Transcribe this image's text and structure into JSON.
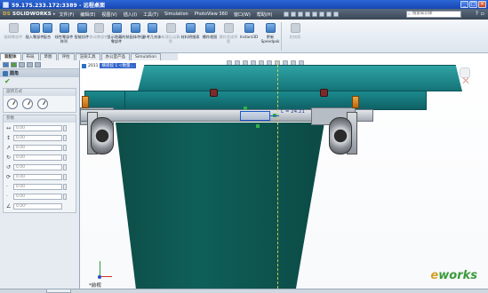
{
  "remote_desktop": {
    "title": "59.175.233.172:3389 - 远程桌面"
  },
  "app": {
    "logo": "SOLIDWORKS",
    "menu": [
      "文件(F)",
      "编辑(E)",
      "视图(V)",
      "插入(I)",
      "工具(T)",
      "Simulation",
      "PhotoView 360",
      "窗口(W)",
      "帮助(H)"
    ],
    "search_placeholder": "搜索知识库"
  },
  "ribbon": {
    "buttons": [
      {
        "label": "编辑零部件",
        "active": false
      },
      {
        "label": "插入零部件",
        "active": true
      },
      {
        "label": "配合",
        "active": true
      },
      {
        "label": "线性零部件阵列",
        "active": true
      },
      {
        "label": "智能扣件",
        "active": true
      },
      {
        "label": "移动零部件",
        "active": false
      },
      {
        "label": "显示隐藏的零部件",
        "active": true
      },
      {
        "label": "装配体特征",
        "active": true
      },
      {
        "label": "参考几何体",
        "active": true
      },
      {
        "label": "新建运动算例",
        "active": false
      },
      {
        "label": "材料明细表",
        "active": true
      },
      {
        "label": "爆炸视图",
        "active": true
      },
      {
        "label": "爆炸直线草图",
        "active": false
      },
      {
        "label": "Instant3D",
        "active": true
      },
      {
        "label": "更新Speedpak",
        "active": true
      },
      {
        "label": "拍快照",
        "active": false
      }
    ]
  },
  "tabs": [
    "装配体",
    "布局",
    "草图",
    "评估",
    "渲染工具",
    "办公室产品",
    "Simulation"
  ],
  "property_manager": {
    "title": "圆角",
    "group_title": "旋转方式",
    "params_title": "参数",
    "fields": [
      "0.00",
      "0.00",
      "0.00",
      "0.00",
      "0.00",
      "0.00",
      "0.00",
      "0.00"
    ],
    "angle_field": "0.00°"
  },
  "viewport": {
    "tree_label": "2011",
    "tree_selected": "横梁段 1 <数量...",
    "dimension": "L = 24.21",
    "view_name": "*前视"
  },
  "watermark": {
    "prefix": "e",
    "text": "works"
  },
  "colors": {
    "accent": "#1646b3",
    "model_teal": "#157478"
  }
}
